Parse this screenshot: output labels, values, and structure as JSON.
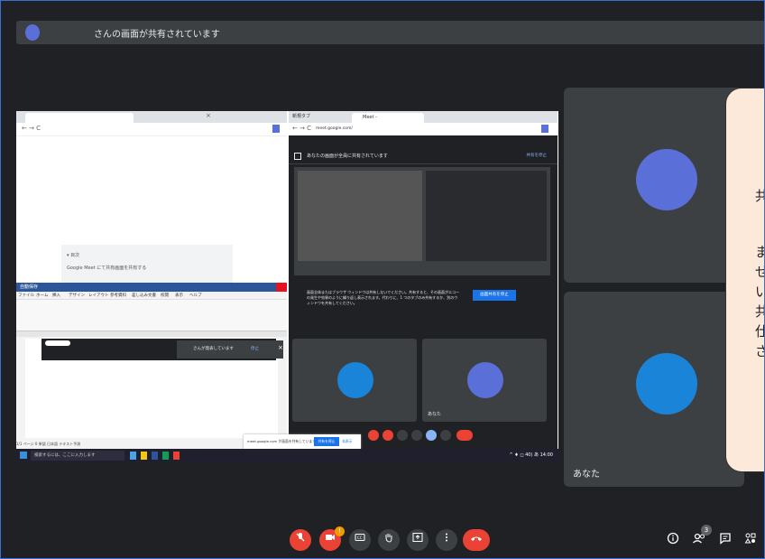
{
  "topbar": {
    "title": "さんの画面が共有されています"
  },
  "left_browser": {
    "tab_close": "×",
    "panel_line1": "▾ 目次",
    "panel_line2": "Google Meet にて共有画面を共有する"
  },
  "word": {
    "title": "自動保存",
    "menu": [
      "ファイル",
      "ホーム",
      "挿入",
      "デザイン",
      "レイアウト",
      "参考資料",
      "差し込み文書",
      "校閲",
      "表示",
      "ヘルプ"
    ],
    "notif_text": "さんが発表しています",
    "notif_stop": "停止",
    "status": "1/1 ページ  0 単語  日本語  テキスト予測"
  },
  "right_browser": {
    "tab1": "新規タブ",
    "tab2": "Meet -",
    "url": "meet.google.com/",
    "banner_text": "あなたの画面が全員に共有されています",
    "banner_stop": "共有を停止",
    "warn_text": "画面全体またはブラウザ ウィンドウは共有しないでください。共有すると、その画面がエコーの発生や効果のように繰り返し表示されます。代わりに、1 つのタブのみ共有するか、別のウィンドウを共有してください。",
    "warn_button": "画面共有を停止",
    "tile2_label": "あなた"
  },
  "share_popup": {
    "text": "meet.google.com が画面を共有しています。",
    "share_button": "共有を停止",
    "hide_button": "非表示"
  },
  "taskbar": {
    "search_placeholder": "検索するには、ここに入力します",
    "tray": "^ ♦ ◻ 40) あ 14:00"
  },
  "right_tiles": {
    "you_label": "あなた"
  },
  "bubble": {
    "lines": [
      "共",
      "ま",
      "せ",
      "い",
      "共",
      "仕",
      "さ"
    ]
  },
  "controls": {
    "mic_icon": "mic-off",
    "cam_badge": "!",
    "participants_count": "3"
  },
  "colors": {
    "avatar_purple": "#5b6fd8",
    "avatar_blue": "#1a85d8",
    "danger": "#ea4335",
    "bubble_bg": "#fde9d9"
  }
}
